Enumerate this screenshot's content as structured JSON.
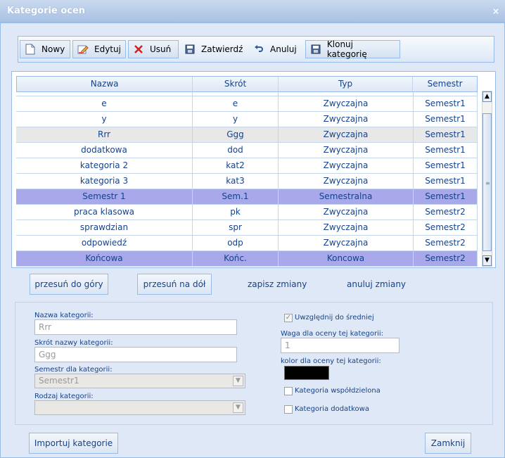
{
  "window": {
    "title": "Kategorie ocen",
    "close": "×"
  },
  "toolbar": {
    "new": "Nowy",
    "edit": "Edytuj",
    "delete": "Usuń",
    "confirm": "Zatwierdź",
    "cancel": "Anuluj",
    "clone": "Klonuj kategorię"
  },
  "grid": {
    "headers": [
      "Nazwa",
      "Skrót",
      "Typ",
      "Semestr"
    ],
    "rows": [
      [
        "e",
        "e",
        "Zwyczajna",
        "Semestr1"
      ],
      [
        "y",
        "y",
        "Zwyczajna",
        "Semestr1"
      ],
      [
        "Rrr",
        "Ggg",
        "Zwyczajna",
        "Semestr1"
      ],
      [
        "dodatkowa",
        "dod",
        "Zwyczajna",
        "Semestr1"
      ],
      [
        "kategoria 2",
        "kat2",
        "Zwyczajna",
        "Semestr1"
      ],
      [
        "kategoria 3",
        "kat3",
        "Zwyczajna",
        "Semestr1"
      ],
      [
        "Semestr 1",
        "Sem.1",
        "Semestralna",
        "Semestr1"
      ],
      [
        "praca klasowa",
        "pk",
        "Zwyczajna",
        "Semestr2"
      ],
      [
        "sprawdzian",
        "spr",
        "Zwyczajna",
        "Semestr2"
      ],
      [
        "odpowiedź",
        "odp",
        "Zwyczajna",
        "Semestr2"
      ],
      [
        "Końcowa",
        "Końc.",
        "Koncowa",
        "Semestr2"
      ]
    ]
  },
  "actions": {
    "move_up": "przesuń do góry",
    "move_down": "przesuń na dół",
    "save": "zapisz zmiany",
    "discard": "anuluj zmiany"
  },
  "form": {
    "name_label": "Nazwa kategorii:",
    "name_value": "Rrr",
    "short_label": "Skrót nazwy kategorii:",
    "short_value": "Ggg",
    "semester_label": "Semestr dla kategorii:",
    "semester_value": "Semestr1",
    "type_label": "Rodzaj kategorii:",
    "type_value": "",
    "include_avg_label": "Uwzględnij do średniej",
    "include_avg_checked": true,
    "weight_label": "Waga dla oceny tej kategorii:",
    "weight_value": "1",
    "color_label": "kolor dla oceny tej kategorii:",
    "color_value": "#000000",
    "shared_label": "Kategoria współdzielona",
    "extra_label": "Kategoria dodatkowa"
  },
  "footer": {
    "import": "Importuj kategorie",
    "close": "Zamknij"
  },
  "colors": {
    "row_selected": "#e8e8e8",
    "row_semester": "#a8a8ea"
  }
}
